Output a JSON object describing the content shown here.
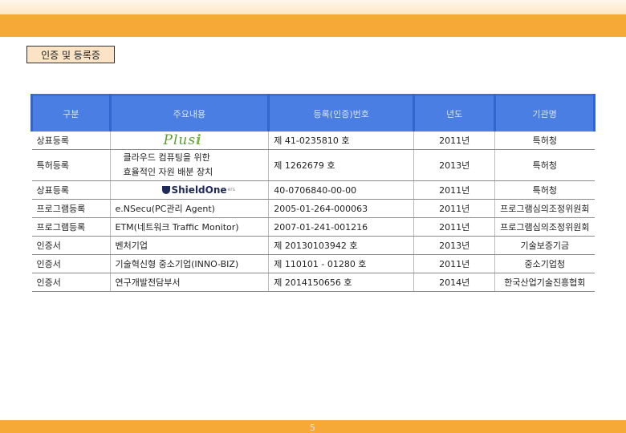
{
  "page_number": "5",
  "section_label": "인증 및 등록증",
  "table": {
    "headers": [
      "구분",
      "주요내용",
      "등록(인증)번호",
      "년도",
      "기관명"
    ],
    "rows": [
      {
        "type": "상표등록",
        "content": "",
        "logo": "Plusi",
        "number": "제 41-0235810 호",
        "year": "2011년",
        "org": "특허청"
      },
      {
        "type": "특허등록",
        "content_line1": "클라우드 컴퓨팅을 위한",
        "content_line2": "효율적인 자원 배분 장치",
        "number": "제 1262679 호",
        "year": "2013년",
        "org": "특허청"
      },
      {
        "type": "상표등록",
        "content": "",
        "logo": "ShieldOne",
        "logo_sub": "ers",
        "number": "40-0706840-00-00",
        "year": "2011년",
        "org": "특허청"
      },
      {
        "type": "프로그램등록",
        "content": "e.NSecu(PC관리 Agent)",
        "number": "2005-01-264-000063",
        "year": "2011년",
        "org": "프로그램심의조정위원회"
      },
      {
        "type": "프로그램등록",
        "content": "ETM(네트워크 Traffic Monitor)",
        "number": "2007-01-241-001216",
        "year": "2011년",
        "org": "프로그램심의조정위원회"
      },
      {
        "type": "인증서",
        "content": "벤처기업",
        "number": "제 20130103942 호",
        "year": "2013년",
        "org": "기술보증기금"
      },
      {
        "type": "인증서",
        "content": "기술혁신형 중소기업(INNO-BIZ)",
        "number": "제 110101 - 01280 호",
        "year": "2011년",
        "org": "중소기업청"
      },
      {
        "type": "인증서",
        "content": "연구개발전담부서",
        "number": "제 2014150656 호",
        "year": "2014년",
        "org": "한국산업기술진흥협회"
      }
    ]
  }
}
